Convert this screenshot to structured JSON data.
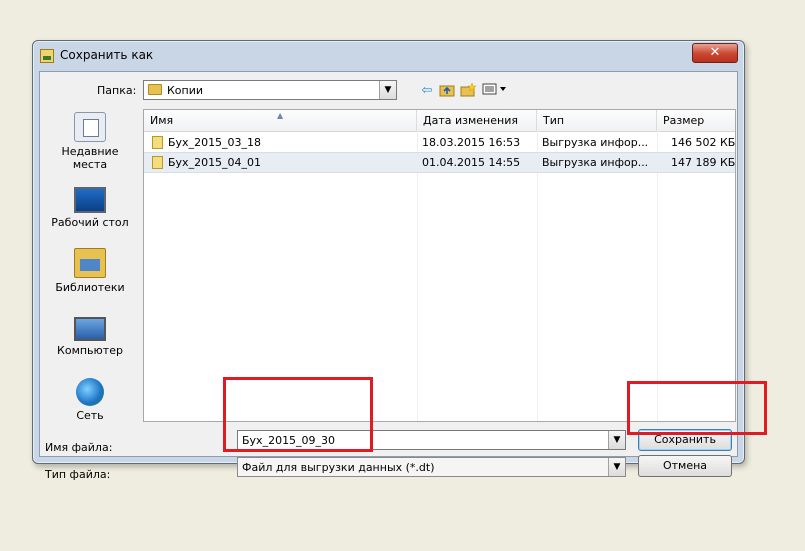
{
  "window": {
    "title": "Сохранить как",
    "close_glyph": "✕"
  },
  "folder": {
    "label": "Папка:",
    "current": "Копии",
    "toolbar_icons": [
      "back-arrow-icon",
      "up-folder-icon",
      "new-folder-icon",
      "view-menu-icon"
    ]
  },
  "places": [
    {
      "label_line1": "Недавние",
      "label_line2": "места",
      "icon": "recent-places-icon"
    },
    {
      "label_line1": "Рабочий стол",
      "label_line2": "",
      "icon": "desktop-icon"
    },
    {
      "label_line1": "Библиотеки",
      "label_line2": "",
      "icon": "libraries-icon"
    },
    {
      "label_line1": "Компьютер",
      "label_line2": "",
      "icon": "computer-icon"
    },
    {
      "label_line1": "Сеть",
      "label_line2": "",
      "icon": "network-icon"
    }
  ],
  "columns": [
    "Имя",
    "Дата изменения",
    "Тип",
    "Размер"
  ],
  "files": [
    {
      "name": "Бух_2015_03_18",
      "date": "18.03.2015 16:53",
      "type": "Выгрузка инфор...",
      "size": "146 502 КБ",
      "selected": false
    },
    {
      "name": "Бух_2015_04_01",
      "date": "01.04.2015 14:55",
      "type": "Выгрузка инфор...",
      "size": "147 189 КБ",
      "selected": true
    }
  ],
  "filename": {
    "label": "Имя файла:",
    "value": "Бух_2015_09_30"
  },
  "filetype": {
    "label": "Тип файла:",
    "value": "Файл для выгрузки данных (*.dt)"
  },
  "buttons": {
    "save": "Сохранить",
    "cancel": "Отмена"
  },
  "colors": {
    "highlight": "#e01b24",
    "desktop_bg": "#efeddf"
  }
}
